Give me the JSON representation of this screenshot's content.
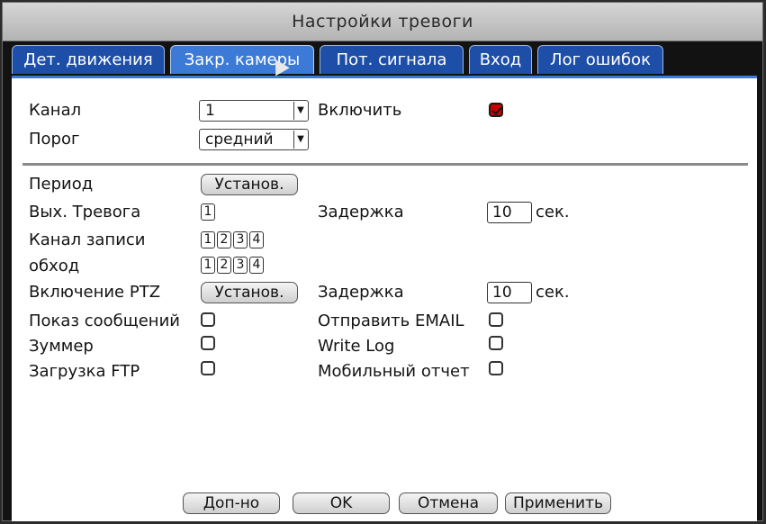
{
  "window": {
    "title": "Настройки тревоги"
  },
  "tabs": [
    {
      "label": "Дет. движения"
    },
    {
      "label": "Закр. камеры",
      "active": true
    },
    {
      "label": "Пот. сигнала"
    },
    {
      "label": "Вход"
    },
    {
      "label": "Лог ошибок"
    }
  ],
  "fields": {
    "channel": {
      "label": "Канал",
      "value": "1"
    },
    "enable": {
      "label": "Включить",
      "checked": true
    },
    "threshold": {
      "label": "Порог",
      "value": "средний"
    },
    "period": {
      "label": "Период",
      "button": "Установ."
    },
    "alarm_out": {
      "label": "Вых. Тревога",
      "channels": [
        "1"
      ]
    },
    "delay1": {
      "label": "Задержка",
      "value": "10",
      "unit": "сек."
    },
    "record_channel": {
      "label": "Канал записи",
      "channels": [
        "1",
        "2",
        "3",
        "4"
      ]
    },
    "tour": {
      "label": "обход",
      "channels": [
        "1",
        "2",
        "3",
        "4"
      ]
    },
    "ptz": {
      "label": "Включение PTZ",
      "button": "Установ."
    },
    "delay2": {
      "label": "Задержка",
      "value": "10",
      "unit": "сек."
    },
    "show_message": {
      "label": "Показ сообщений",
      "checked": false
    },
    "send_email": {
      "label": "Отправить EMAIL",
      "checked": false
    },
    "buzzer": {
      "label": "Зуммер",
      "checked": false
    },
    "write_log": {
      "label": "Write Log",
      "checked": false
    },
    "ftp_upload": {
      "label": "Загрузка FTP",
      "checked": false
    },
    "mobile_report": {
      "label": "Мобильный отчет",
      "checked": false
    }
  },
  "footer": {
    "advanced": "Доп-но",
    "ok": "OK",
    "cancel": "Отмена",
    "apply": "Применить"
  },
  "colors": {
    "tab": "#1e4fa8",
    "tab_active": "#3c7ad8",
    "checkbox_checked": "#c80000"
  }
}
